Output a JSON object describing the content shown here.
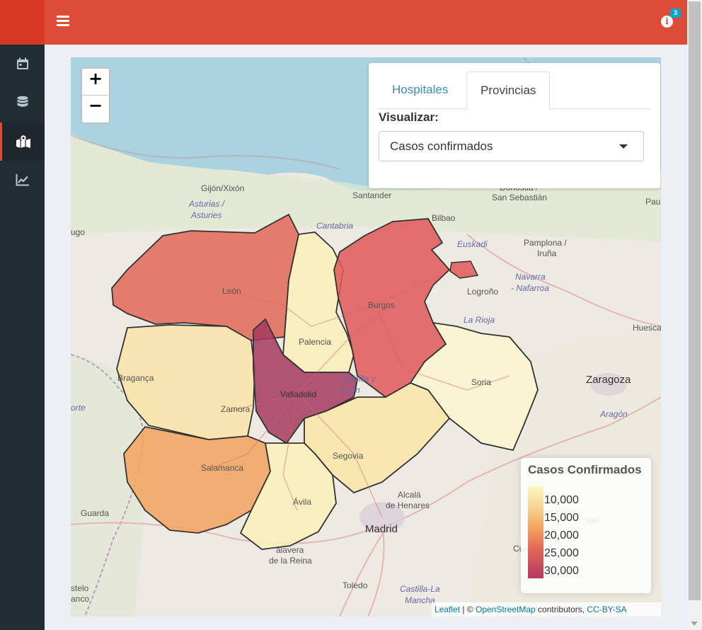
{
  "header": {
    "menu_icon": "hamburger-icon",
    "info_icon": "info-circle-icon",
    "info_badge": "3",
    "color": "#dd4b39"
  },
  "sidebar": {
    "items": [
      {
        "icon": "calendar-icon",
        "active": false
      },
      {
        "icon": "database-icon",
        "active": false
      },
      {
        "icon": "map-marked-icon",
        "active": true
      },
      {
        "icon": "chart-line-icon",
        "active": false
      }
    ]
  },
  "map": {
    "zoom_in": "+",
    "zoom_out": "−",
    "tabs": [
      "Hospitales",
      "Provincias"
    ],
    "active_tab": "Provincias",
    "visualize_label": "Visualizar:",
    "select_value": "Casos confirmados",
    "legend": {
      "title": "Casos Confirmados",
      "ticks": [
        "10,000",
        "15,000",
        "20,000",
        "25,000",
        "30,000"
      ],
      "colors": [
        "#fdf6c0",
        "#f7d796",
        "#f3a35e",
        "#e36858",
        "#b5395f"
      ]
    },
    "attribution": {
      "leaflet": "Leaflet",
      "sep": " | © ",
      "osm": "OpenStreetMap",
      "contrib": " contributors, ",
      "license": "CC-BY-SA"
    },
    "provinces": [
      {
        "name": "León",
        "color": "#e36858"
      },
      {
        "name": "Palencia",
        "color": "#fdf0b8"
      },
      {
        "name": "Burgos",
        "color": "#e05858"
      },
      {
        "name": "Soria",
        "color": "#fdf6d0"
      },
      {
        "name": "Zamora",
        "color": "#fbe4a8"
      },
      {
        "name": "Valladolid",
        "color": "#a4395f"
      },
      {
        "name": "Segovia",
        "color": "#fbe6a8"
      },
      {
        "name": "Salamanca",
        "color": "#f3a35e"
      },
      {
        "name": "Ávila",
        "color": "#fdf0b8"
      }
    ],
    "labels": {
      "gijon": "Gijón/Xixón",
      "asturias1": "Asturias /",
      "asturias2": "Asturies",
      "santander": "Santander",
      "donostia": "Donostia /",
      "sansebastian": "San Sebastián",
      "pau": "Pau",
      "bilbao": "Bilbao",
      "cantabria": "Cantabria",
      "euskadi": "Euskadi",
      "pamplona1": "Pamplona /",
      "pamplona2": "Iruña",
      "navarra1": "Navarra",
      "navarra2": "- Nafarroa",
      "logrono": "Logroño",
      "larioja": "La Rioja",
      "huesca": "Huesca",
      "lugo": "ugo",
      "leon": "León",
      "burgos": "Burgos",
      "palencia": "Palencia",
      "braganca": "Bragança",
      "valladolid": "Valladolid",
      "castilla1": "Castilla y",
      "castilla2": "León",
      "soria": "Soria",
      "zaragoza": "Zaragoza",
      "norte": "orte",
      "zamora": "Zamora",
      "aragon": "Aragón",
      "segovia": "Segovia",
      "salamanca": "Salamanca",
      "alcala1": "Alcalá",
      "alcala2": "de Henares",
      "guarda": "Guarda",
      "avila": "Ávila",
      "madrid": "Madrid",
      "teruel": "ruel",
      "talavera1": "alavera",
      "talavera2": "de la Reina",
      "cuenca": "Cuenca",
      "castelo1": "stelo",
      "castelo2": "anco",
      "toledo": "Toledo",
      "clm1": "Castilla-La",
      "clm2": "Mancha"
    }
  }
}
